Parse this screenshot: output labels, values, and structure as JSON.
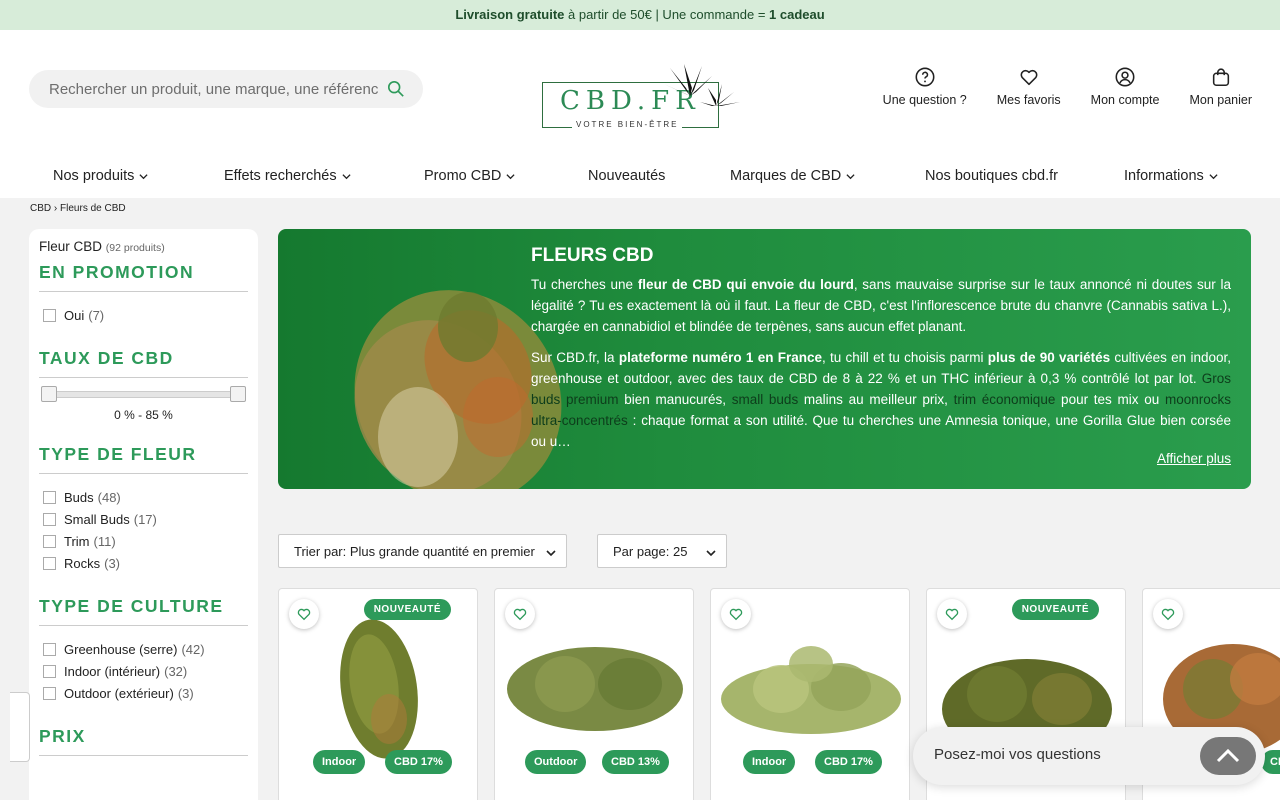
{
  "banner": {
    "part1": "Livraison gratuite",
    "part2": " à partir de 50€ | Une commande = ",
    "part3": "1 cadeau"
  },
  "search": {
    "placeholder": "Rechercher un produit, une marque, une référence"
  },
  "logo": {
    "name": "CBD.FR",
    "tagline": "VOTRE BIEN-ÊTRE"
  },
  "header_actions": [
    {
      "label": "Une question ?",
      "icon": "question-circle-icon"
    },
    {
      "label": "Mes favoris",
      "icon": "heart-icon"
    },
    {
      "label": "Mon compte",
      "icon": "user-icon"
    },
    {
      "label": "Mon panier",
      "icon": "bag-icon"
    }
  ],
  "nav": [
    {
      "label": "Nos produits",
      "dropdown": true
    },
    {
      "label": "Effets recherchés",
      "dropdown": true
    },
    {
      "label": "Promo CBD",
      "dropdown": true
    },
    {
      "label": "Nouveautés",
      "dropdown": false
    },
    {
      "label": "Marques de CBD",
      "dropdown": true
    },
    {
      "label": "Nos boutiques cbd.fr",
      "dropdown": false
    },
    {
      "label": "Informations",
      "dropdown": true
    }
  ],
  "breadcrumb": {
    "home": "CBD",
    "sep": "›",
    "current": "Fleurs de CBD"
  },
  "sidebar": {
    "title": "Fleur CBD",
    "count": "(92 produits)",
    "promo": {
      "heading": "EN PROMOTION",
      "items": [
        {
          "label": "Oui",
          "count": "(7)"
        }
      ]
    },
    "taux": {
      "heading": "TAUX DE CBD",
      "range": "0 % - 85 %"
    },
    "type_fleur": {
      "heading": "TYPE DE FLEUR",
      "items": [
        {
          "label": "Buds",
          "count": "(48)"
        },
        {
          "label": "Small Buds",
          "count": "(17)"
        },
        {
          "label": "Trim",
          "count": "(11)"
        },
        {
          "label": "Rocks",
          "count": "(3)"
        }
      ]
    },
    "type_culture": {
      "heading": "TYPE DE CULTURE",
      "items": [
        {
          "label": "Greenhouse (serre)",
          "count": "(42)"
        },
        {
          "label": "Indoor (intérieur)",
          "count": "(32)"
        },
        {
          "label": "Outdoor (extérieur)",
          "count": "(3)"
        }
      ]
    },
    "prix": {
      "heading": "PRIX"
    }
  },
  "hero": {
    "title": "FLEURS CBD",
    "p1_a": "Tu cherches une ",
    "p1_b": "fleur de CBD qui envoie du lourd",
    "p1_c": ", sans mauvaise surprise sur le taux annoncé ni doutes sur la légalité ? Tu es exactement là où il faut. La fleur de CBD, c'est l'inflorescence brute du chanvre (Cannabis sativa L.), chargée en cannabidiol et blindée de terpènes, sans aucun effet planant.",
    "p2_a": "Sur CBD.fr, la ",
    "p2_b": "plateforme numéro 1 en France",
    "p2_c": ", tu chill et tu choisis parmi ",
    "p2_d": "plus de 90 variétés",
    "p2_e": " cultivées en indoor, greenhouse et outdoor, avec des taux de CBD de 8 à 22 % et un THC inférieur à 0,3 % contrôlé lot par lot. ",
    "p2_link1": "Gros buds premium",
    "p2_f": " bien manucurés, ",
    "p2_link2": "small buds",
    "p2_g": " malins au meilleur prix, ",
    "p2_link3": "trim économique",
    "p2_h": " pour tes mix ou ",
    "p2_link4": "moonrocks ultra-concentrés",
    "p2_i": " : chaque format a son utilité. Que tu cherches une Amnesia tonique, une Gorilla Glue bien corsée ou u…",
    "more": "Afficher plus"
  },
  "sort": {
    "label": "Trier par: Plus grande quantité en premier"
  },
  "perpage": {
    "label": "Par page: 25"
  },
  "products": [
    {
      "new": "NOUVEAUTÉ",
      "culture": "Indoor",
      "cbd": "CBD 17%"
    },
    {
      "new": "",
      "culture": "Outdoor",
      "cbd": "CBD 13%"
    },
    {
      "new": "",
      "culture": "Indoor",
      "cbd": "CBD 17%"
    },
    {
      "new": "NOUVEAUTÉ",
      "culture": "",
      "cbd": ""
    },
    {
      "new": "",
      "culture": "",
      "cbd": "CBD"
    }
  ],
  "chat": {
    "placeholder": "Posez-moi vos questions"
  },
  "colors": {
    "accent": "#2d9a5a",
    "banner_bg": "#d7ecd9",
    "hero_start": "#15792f",
    "hero_end": "#2a9d4d"
  }
}
